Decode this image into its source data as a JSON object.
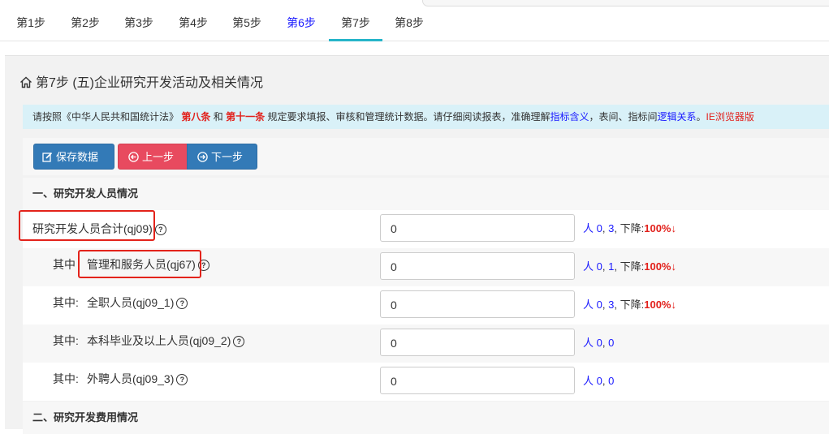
{
  "tabs": [
    {
      "label": "第1步",
      "state": "normal"
    },
    {
      "label": "第2步",
      "state": "normal"
    },
    {
      "label": "第3步",
      "state": "normal"
    },
    {
      "label": "第4步",
      "state": "normal"
    },
    {
      "label": "第5步",
      "state": "normal"
    },
    {
      "label": "第6步",
      "state": "visited"
    },
    {
      "label": "第7步",
      "state": "active"
    },
    {
      "label": "第8步",
      "state": "normal"
    }
  ],
  "page_title": "第7步 (五)企业研究开发活动及相关情况",
  "notice": {
    "p1": "请按照《中华人民共和国统计法》",
    "law1": "第八条",
    "and": "和",
    "law2": "第十一条",
    "p2": "规定要求填报、审核和管理统计数据。请仔细阅读报表，准确理解",
    "link1": "指标含义",
    "p3": "，表间、指标间",
    "link2": "逻辑关系",
    "p4": "。",
    "ie": "IE浏览器版"
  },
  "buttons": {
    "save": "保存数据",
    "prev": "上一步",
    "next": "下一步"
  },
  "sections": {
    "s1": "一、研究开发人员情况",
    "s2": "二、研究开发费用情况"
  },
  "rows": [
    {
      "prefix": "",
      "label": "研究开发人员合计(qj09)",
      "value": "0",
      "unit": "人",
      "v1": "0",
      "v2": "3",
      "drop_label": "下降:",
      "drop": "100%",
      "arrow": "↓"
    },
    {
      "prefix": "其中",
      "label": "管理和服务人员(qj67)",
      "value": "0",
      "unit": "人",
      "v1": "0",
      "v2": "1",
      "drop_label": "下降:",
      "drop": "100%",
      "arrow": "↓"
    },
    {
      "prefix": "其中:",
      "label": "全职人员(qj09_1)",
      "value": "0",
      "unit": "人",
      "v1": "0",
      "v2": "3",
      "drop_label": "下降:",
      "drop": "100%",
      "arrow": "↓"
    },
    {
      "prefix": "其中:",
      "label": "本科毕业及以上人员(qj09_2)",
      "value": "0",
      "unit": "人",
      "v1": "0",
      "v2": "0",
      "drop_label": "",
      "drop": "",
      "arrow": ""
    },
    {
      "prefix": "其中:",
      "label": "外聘人员(qj09_3)",
      "value": "0",
      "unit": "人",
      "v1": "0",
      "v2": "0",
      "drop_label": "",
      "drop": "",
      "arrow": ""
    }
  ],
  "sep": ",",
  "help_glyph": "?",
  "colors": {
    "accent": "#26b5c9",
    "save": "#337ab7",
    "prev": "#e84a5f",
    "highlight": "#e3231b",
    "link": "#1a1aff"
  }
}
